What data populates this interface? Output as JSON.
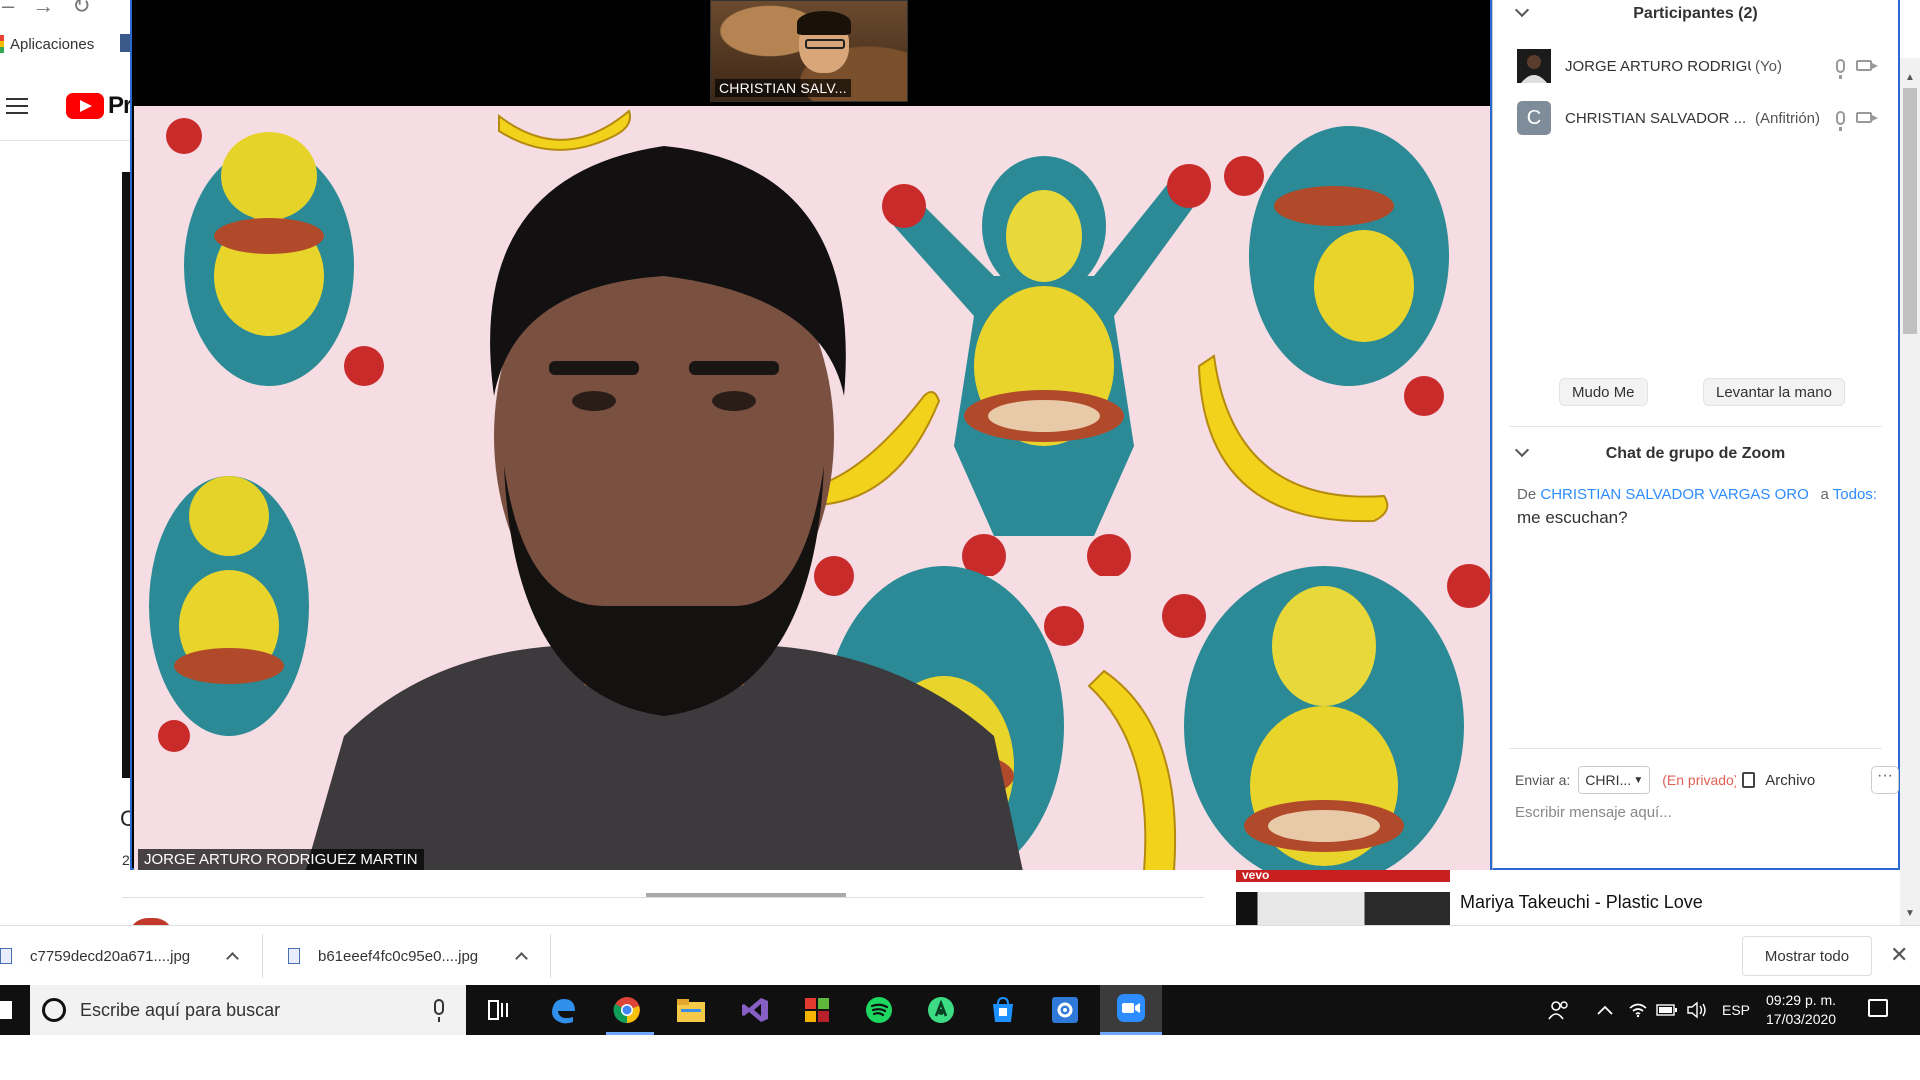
{
  "browser": {
    "bookmark_apps": "Aplicaciones",
    "youtube_logo_text": "Prer",
    "cut_text_c": "C",
    "cut_text_2": "2",
    "rec_thumb_label": "vevo",
    "rec_video_title": "Mariya Takeuchi - Plastic Love"
  },
  "zoom": {
    "self_thumbnail_label": "CHRISTIAN SALV...",
    "main_video_label": "JORGE ARTURO RODRIGUEZ MARTIN",
    "participants_title": "Participantes (2)",
    "participants": [
      {
        "name": "JORGE ARTURO RODRIGUEZ ...",
        "role": "(Yo)",
        "avatar": ""
      },
      {
        "name": "CHRISTIAN SALVADOR ...",
        "role": "(Anfitrión)",
        "avatar": "C"
      }
    ],
    "mute_button": "Mudo Me",
    "raise_hand_button": "Levantar la mano",
    "chat_title": "Chat de grupo de Zoom",
    "chat": {
      "from_prefix": "De",
      "from_name": "CHRISTIAN SALVADOR VARGAS OROZ...",
      "to_prefix": "a",
      "to_name": "Todos:",
      "message": "me escuchan?"
    },
    "send_to_label": "Enviar a:",
    "send_to_value": "CHRI...",
    "private_label": "(En privado)",
    "file_label": "Archivo",
    "more_label": "···",
    "chat_placeholder": "Escribir mensaje aquí..."
  },
  "downloads": {
    "items": [
      {
        "file": "c7759decd20a671....jpg"
      },
      {
        "file": "b61eeef4fc0c95e0....jpg"
      }
    ],
    "show_all": "Mostrar todo",
    "close": "✕"
  },
  "taskbar": {
    "search_placeholder": "Escribe aquí para buscar",
    "language": "ESP",
    "time": "09:29 p. m.",
    "date": "17/03/2020"
  },
  "colors": {
    "zoom_blue": "#2d8cff",
    "video_bg": "#f6dde3",
    "private_red": "#e06055",
    "taskbar": "#101010"
  }
}
